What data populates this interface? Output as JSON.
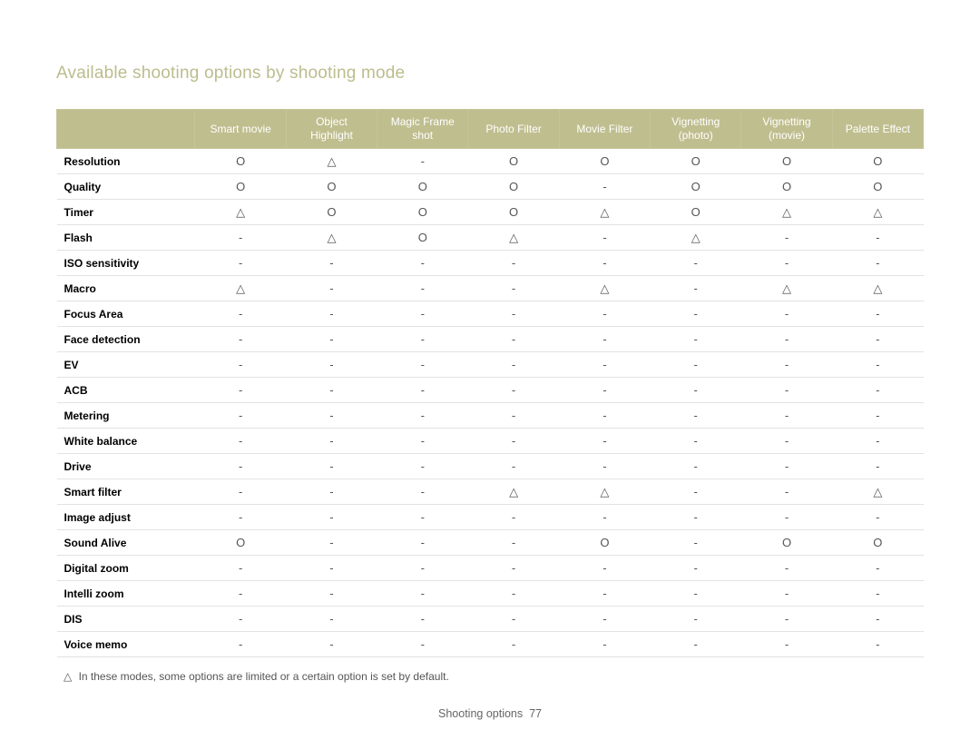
{
  "title": "Available shooting options by shooting mode",
  "symbols": {
    "circle": "O",
    "triangle": "△",
    "dash": "-"
  },
  "columns": [
    "Smart movie",
    "Object\nHighlight",
    "Magic Frame\nshot",
    "Photo Filter",
    "Movie Filter",
    "Vignetting\n(photo)",
    "Vignetting\n(movie)",
    "Palette Effect"
  ],
  "rows": [
    {
      "name": "Resolution",
      "cells": [
        "O",
        "△",
        "-",
        "O",
        "O",
        "O",
        "O",
        "O"
      ]
    },
    {
      "name": "Quality",
      "cells": [
        "O",
        "O",
        "O",
        "O",
        "-",
        "O",
        "O",
        "O"
      ]
    },
    {
      "name": "Timer",
      "cells": [
        "△",
        "O",
        "O",
        "O",
        "△",
        "O",
        "△",
        "△"
      ]
    },
    {
      "name": "Flash",
      "cells": [
        "-",
        "△",
        "O",
        "△",
        "-",
        "△",
        "-",
        "-"
      ]
    },
    {
      "name": "ISO sensitivity",
      "cells": [
        "-",
        "-",
        "-",
        "-",
        "-",
        "-",
        "-",
        "-"
      ]
    },
    {
      "name": "Macro",
      "cells": [
        "△",
        "-",
        "-",
        "-",
        "△",
        "-",
        "△",
        "△"
      ]
    },
    {
      "name": "Focus Area",
      "cells": [
        "-",
        "-",
        "-",
        "-",
        "-",
        "-",
        "-",
        "-"
      ]
    },
    {
      "name": "Face detection",
      "cells": [
        "-",
        "-",
        "-",
        "-",
        "-",
        "-",
        "-",
        "-"
      ]
    },
    {
      "name": "EV",
      "cells": [
        "-",
        "-",
        "-",
        "-",
        "-",
        "-",
        "-",
        "-"
      ]
    },
    {
      "name": "ACB",
      "cells": [
        "-",
        "-",
        "-",
        "-",
        "-",
        "-",
        "-",
        "-"
      ]
    },
    {
      "name": "Metering",
      "cells": [
        "-",
        "-",
        "-",
        "-",
        "-",
        "-",
        "-",
        "-"
      ]
    },
    {
      "name": "White balance",
      "cells": [
        "-",
        "-",
        "-",
        "-",
        "-",
        "-",
        "-",
        "-"
      ]
    },
    {
      "name": "Drive",
      "cells": [
        "-",
        "-",
        "-",
        "-",
        "-",
        "-",
        "-",
        "-"
      ]
    },
    {
      "name": "Smart filter",
      "cells": [
        "-",
        "-",
        "-",
        "△",
        "△",
        "-",
        "-",
        "△"
      ]
    },
    {
      "name": "Image adjust",
      "cells": [
        "-",
        "-",
        "-",
        "-",
        "-",
        "-",
        "-",
        "-"
      ]
    },
    {
      "name": "Sound Alive",
      "cells": [
        "O",
        "-",
        "-",
        "-",
        "O",
        "-",
        "O",
        "O"
      ]
    },
    {
      "name": "Digital zoom",
      "cells": [
        "-",
        "-",
        "-",
        "-",
        "-",
        "-",
        "-",
        "-"
      ]
    },
    {
      "name": "Intelli zoom",
      "cells": [
        "-",
        "-",
        "-",
        "-",
        "-",
        "-",
        "-",
        "-"
      ]
    },
    {
      "name": "DIS",
      "cells": [
        "-",
        "-",
        "-",
        "-",
        "-",
        "-",
        "-",
        "-"
      ]
    },
    {
      "name": "Voice memo",
      "cells": [
        "-",
        "-",
        "-",
        "-",
        "-",
        "-",
        "-",
        "-"
      ]
    }
  ],
  "footnote": "In these modes, some options are limited or a certain option is set by default.",
  "footer": {
    "section": "Shooting options",
    "page": "77"
  }
}
